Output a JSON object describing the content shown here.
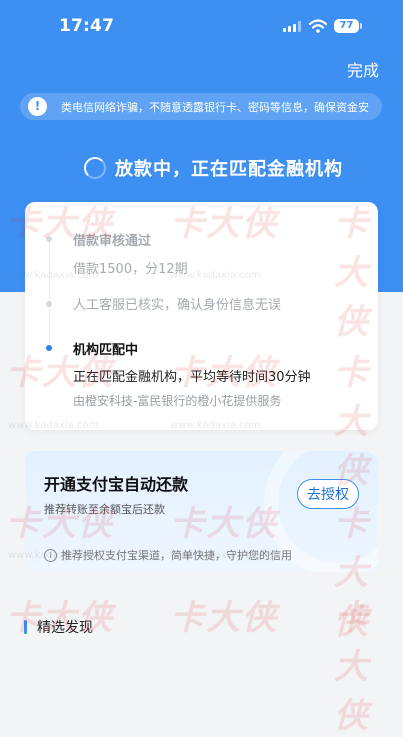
{
  "status_bar": {
    "time": "17:47",
    "battery": "77"
  },
  "header": {
    "done_label": "完成"
  },
  "notice": {
    "icon": "shield-icon",
    "text": "类电信网络诈骗，不随意透露银行卡、密码等信息，确保资金安"
  },
  "loading": {
    "text": "放款中，正在匹配金融机构"
  },
  "timeline": {
    "steps": [
      {
        "title": "借款审核通过",
        "detail": "借款1500，分12期",
        "state": "done"
      },
      {
        "title": "",
        "detail": "人工客服已核实，确认身份信息无误",
        "state": "done"
      },
      {
        "title": "机构匹配中",
        "detail": "正在匹配金融机构，平均等待时间30分钟",
        "sub": "由橙安科技-富民银行的橙小花提供服务",
        "state": "active"
      }
    ]
  },
  "promo": {
    "title": "开通支付宝自动还款",
    "desc": "推荐转账至余额宝后还款",
    "button": "去授权",
    "footnote": "推荐授权支付宝渠道，简单快捷，守护您的信用"
  },
  "discover": {
    "label": "精选发现"
  },
  "watermark": {
    "text": "卡大侠",
    "url": "www.kadaxia.com"
  },
  "colors": {
    "primary": "#3d8ff2",
    "active_dot": "#2f80ed",
    "muted": "#9aa0a6"
  }
}
